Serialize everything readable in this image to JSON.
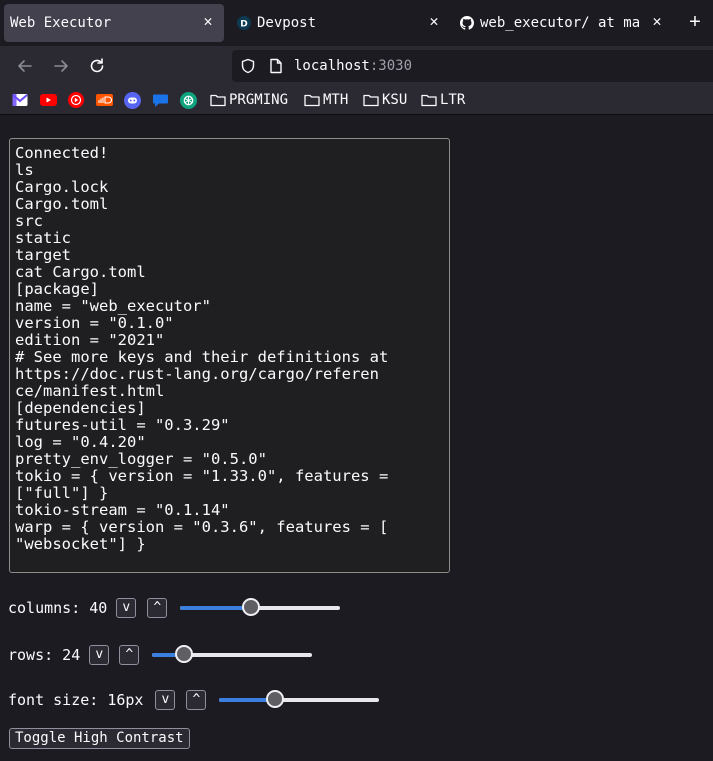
{
  "browser": {
    "tabs": [
      {
        "label": "Web Executor",
        "active": true
      },
      {
        "label": "Devpost",
        "active": false,
        "icon": "D"
      },
      {
        "label": "web_executor/ at ma",
        "active": false
      }
    ],
    "new_tab_label": "+",
    "url": {
      "host": "localhost",
      "port": ":3030"
    },
    "bookmark_folders": [
      "PRGMING",
      "MTH",
      "KSU",
      "LTR"
    ]
  },
  "terminal": {
    "lines": [
      "Connected!",
      "ls",
      "Cargo.lock",
      "Cargo.toml",
      "src",
      "static",
      "target",
      "cat Cargo.toml",
      "[package]",
      "name = \"web_executor\"",
      "version = \"0.1.0\"",
      "edition = \"2021\"",
      "# See more keys and their definitions at",
      "https://doc.rust-lang.org/cargo/referen",
      "ce/manifest.html",
      "[dependencies]",
      "futures-util = \"0.3.29\"",
      "log = \"0.4.20\"",
      "pretty_env_logger = \"0.5.0\"",
      "tokio = { version = \"1.33.0\", features =",
      "[\"full\"] }",
      "tokio-stream = \"0.1.14\"",
      "warp = { version = \"0.3.6\", features = [",
      "\"websocket\"] }"
    ]
  },
  "controls": {
    "columns": {
      "label": "columns: 40",
      "down": "v",
      "up": "^",
      "level": 0.44
    },
    "rows": {
      "label": "rows: 24",
      "down": "v",
      "up": "^",
      "level": 0.2
    },
    "font_size": {
      "label": "font size: 16px",
      "down": "v",
      "up": "^",
      "level": 0.35
    },
    "high_contrast_label": "Toggle High Contrast"
  },
  "colors": {
    "accent": "#3b7fe0",
    "background": "#1c1b22"
  }
}
